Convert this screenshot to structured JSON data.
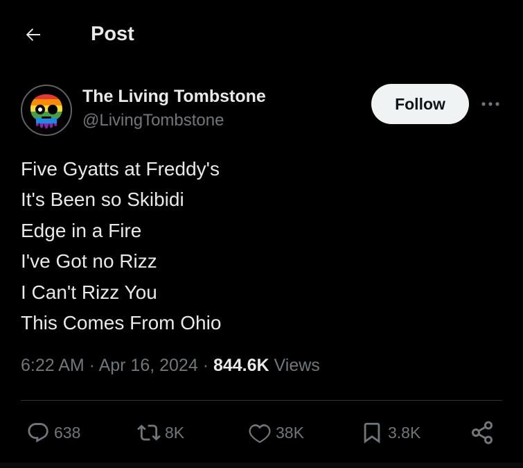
{
  "header": {
    "title": "Post",
    "back_icon": "arrow-left-icon"
  },
  "author": {
    "display_name": "The Living Tombstone",
    "handle": "@LivingTombstone",
    "avatar_icon": "rainbow-skull-avatar",
    "follow_label": "Follow",
    "more_icon": "more-dots-icon"
  },
  "post": {
    "lines": [
      "Five Gyatts at Freddy's",
      "It's Been so Skibidi",
      "Edge in a Fire",
      "I've Got no Rizz",
      "I Can't Rizz You",
      "This Comes From Ohio"
    ]
  },
  "meta": {
    "time": "6:22 AM",
    "separator": " · ",
    "date": "Apr 16, 2024",
    "views_count": "844.6K",
    "views_label": " Views"
  },
  "actions": {
    "replies": "638",
    "reposts": "8K",
    "likes": "38K",
    "bookmarks": "3.8K"
  },
  "colors": {
    "background": "#000000",
    "text_primary": "#e7e9ea",
    "text_secondary": "#71767b",
    "follow_button_bg": "#eff3f4",
    "divider": "#2f3336"
  }
}
